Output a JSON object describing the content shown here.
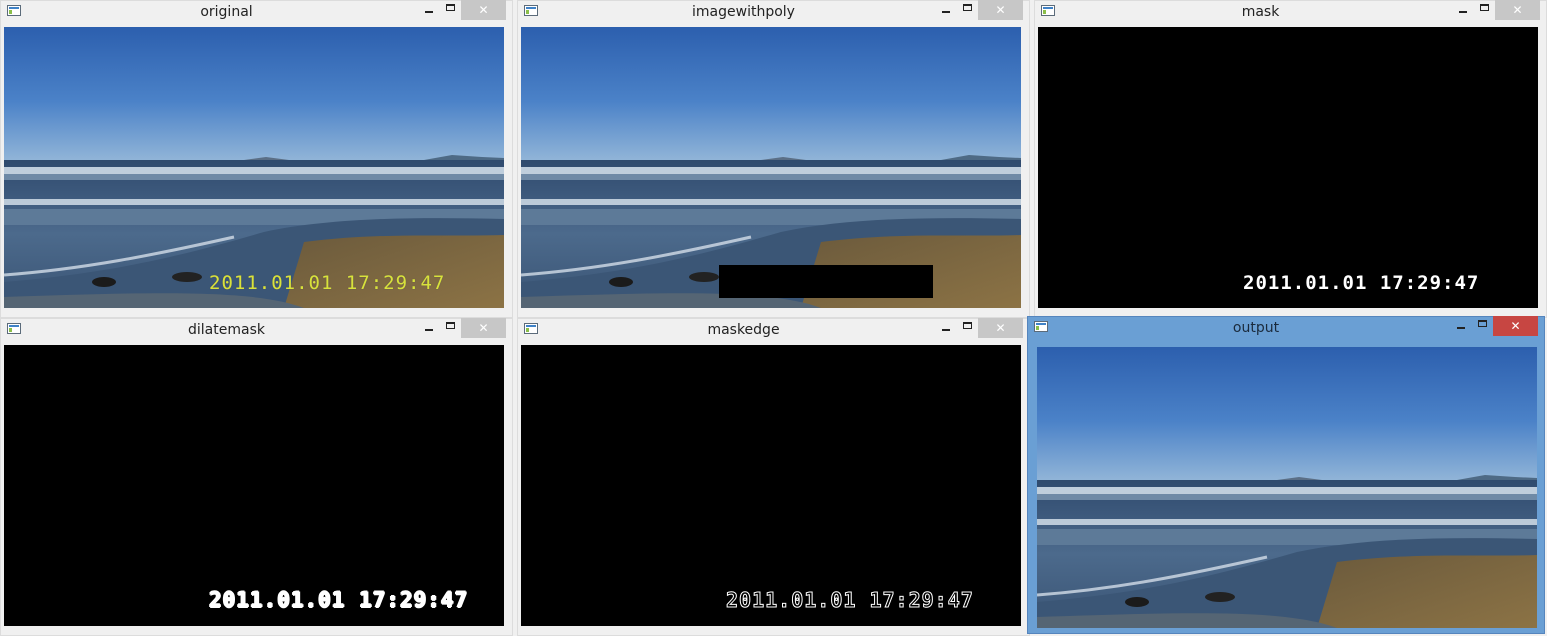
{
  "windows": [
    {
      "title": "original",
      "close_glyph": "✕",
      "timestamp": "2011.01.01 17:29:47"
    },
    {
      "title": "imagewithpoly",
      "close_glyph": "✕"
    },
    {
      "title": "mask",
      "close_glyph": "✕",
      "timestamp": "2011.01.01 17:29:47"
    },
    {
      "title": "dilatemask",
      "close_glyph": "✕",
      "timestamp": "2011.01.01 17:29:47"
    },
    {
      "title": "maskedge",
      "close_glyph": "✕",
      "timestamp": "2011.01.01 17:29:47"
    },
    {
      "title": "output",
      "close_glyph": "✕"
    }
  ],
  "icons": {
    "app": "window-app-icon",
    "minimize": "minimize-icon",
    "maximize": "maximize-icon",
    "close": "close-icon"
  },
  "colors": {
    "active_frame": "#6a9fd4",
    "active_close": "#c74642",
    "inactive_close": "#c7c7c7",
    "timestamp_overlay": "#d9e23a"
  },
  "active_window": "output"
}
